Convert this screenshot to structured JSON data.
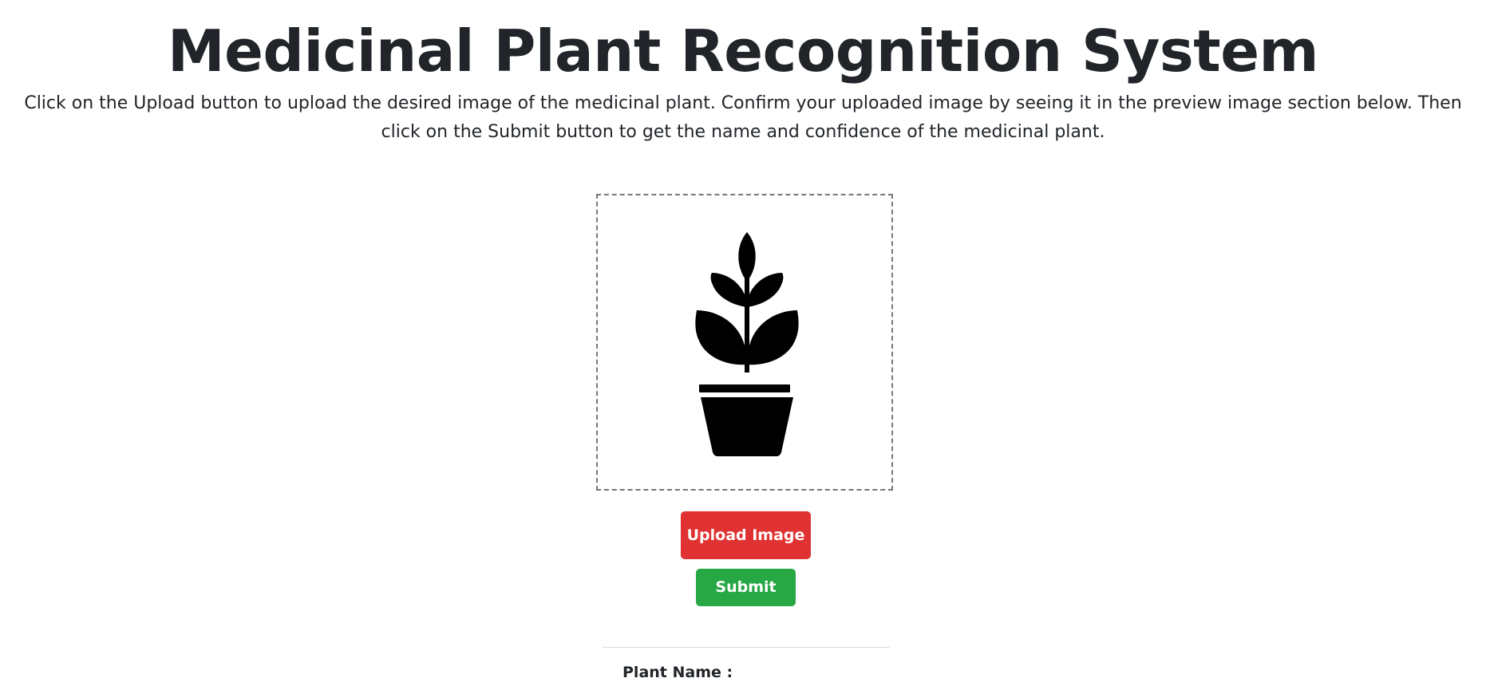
{
  "header": {
    "title": "Medicinal Plant Recognition System",
    "description": "Click on the Upload button to upload the desired image of the medicinal plant. Confirm your uploaded image by seeing it in the preview image section below. Then click on the Submit button to get the name and confidence of the medicinal plant."
  },
  "preview": {
    "icon": "potted-plant-icon"
  },
  "buttons": {
    "upload_label": "Upload Image",
    "submit_label": "Submit"
  },
  "results": {
    "plant_name_label": "Plant Name :",
    "plant_name_value": ""
  },
  "colors": {
    "upload": "#e03232",
    "submit": "#28a745",
    "text": "#212529"
  }
}
